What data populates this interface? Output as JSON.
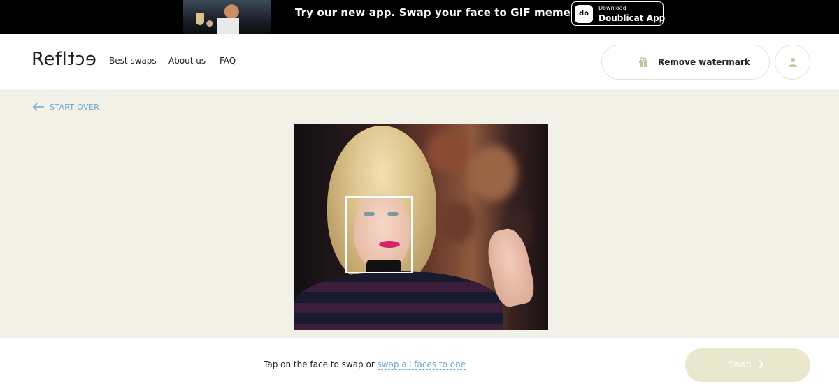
{
  "banner": {
    "promo_text": "Try our new app. Swap your face to GIF memes.",
    "app_button": {
      "small_label": "Download",
      "big_label": "Doublicat App",
      "icon_text": "do"
    }
  },
  "header": {
    "logo": {
      "prefix": "Refl",
      "mirrored": "ect"
    },
    "nav": [
      "Best swaps",
      "About us",
      "FAQ"
    ],
    "remove_watermark_label": "Remove watermark",
    "icons": {
      "watermark": "gift-icon",
      "account": "user-icon"
    }
  },
  "main": {
    "start_over_label": "START OVER",
    "start_over_icon": "arrow-left-icon",
    "image_alt": "Uploaded photo with detected face"
  },
  "footer": {
    "hint_prefix": "Tap on the face to swap or ",
    "hint_link": "swap all faces to one",
    "swap_label": "Swap",
    "swap_icon": "chevron-right-icon"
  },
  "colors": {
    "background": "#f2f1e8",
    "link": "#6ea7d8",
    "banner_bg": "#000000",
    "swap_disabled": "#e9e8cf",
    "accent_border": "#e6e3cc"
  }
}
